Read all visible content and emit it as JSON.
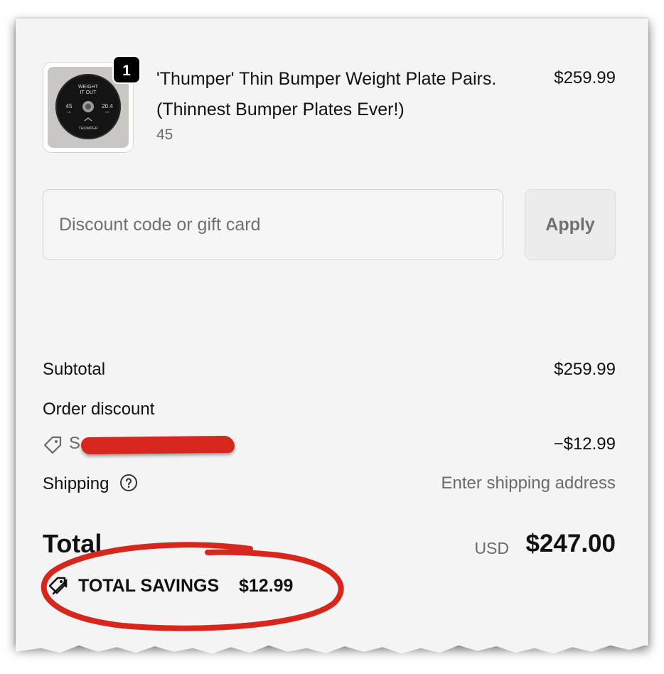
{
  "cart": {
    "item": {
      "quantity_badge": "1",
      "title": "'Thumper' Thin Bumper Weight Plate Pairs. (Thinnest Bumper Plates Ever!)",
      "variant": "45",
      "price": "$259.99",
      "image_text": {
        "line1": "WEIGHT",
        "line2": "IT OUT",
        "left": "45",
        "left_unit": "LB",
        "right": "20.4",
        "right_unit": "KG",
        "brand": "THUMPER"
      }
    },
    "discount": {
      "placeholder": "Discount code or gift card",
      "value": "",
      "apply_label": "Apply"
    },
    "summary": {
      "subtotal_label": "Subtotal",
      "subtotal_value": "$259.99",
      "order_discount_label": "Order discount",
      "code_visible": "S",
      "code_discount_value": "−$12.99",
      "shipping_label": "Shipping",
      "shipping_value": "Enter shipping address",
      "total_label": "Total",
      "currency": "USD",
      "total_value": "$247.00",
      "savings_label": "TOTAL SAVINGS",
      "savings_value": "$12.99"
    },
    "colors": {
      "annotation_red": "#d7261c",
      "background": "#f4f4f4",
      "muted_text": "#6b6b6b"
    }
  }
}
